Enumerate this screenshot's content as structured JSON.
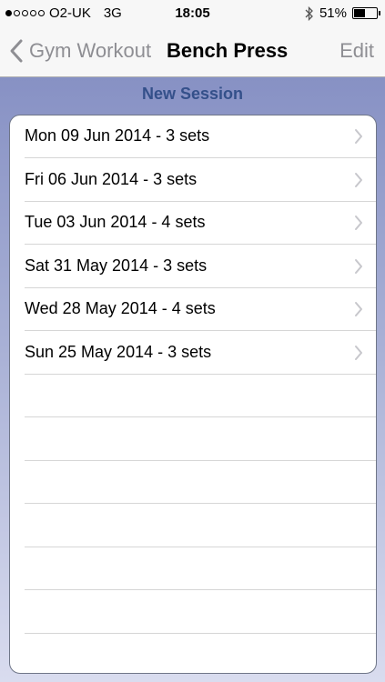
{
  "status_bar": {
    "carrier": "O2-UK",
    "network": "3G",
    "time": "18:05",
    "battery_percent": "51%",
    "battery_level": 0.51,
    "signal_bars_filled": 1,
    "signal_bars_total": 5
  },
  "nav": {
    "back_label": "Gym Workout",
    "title": "Bench Press",
    "edit_label": "Edit"
  },
  "new_session_label": "New Session",
  "sessions": [
    {
      "label": "Mon 09 Jun 2014 - 3 sets"
    },
    {
      "label": "Fri 06 Jun 2014 - 3 sets"
    },
    {
      "label": "Tue 03 Jun 2014 - 4 sets"
    },
    {
      "label": "Sat 31 May 2014 - 3 sets"
    },
    {
      "label": "Wed 28 May 2014 - 4 sets"
    },
    {
      "label": "Sun 25 May 2014 - 3 sets"
    }
  ],
  "colors": {
    "accent": "#34508a",
    "nav_gray": "#8e8e93",
    "background_top": "#8791c4",
    "background_bottom": "#d9dcef"
  },
  "icons": {
    "back": "chevron-left-icon",
    "row": "chevron-right-icon",
    "bluetooth": "bluetooth-icon",
    "battery": "battery-icon"
  }
}
